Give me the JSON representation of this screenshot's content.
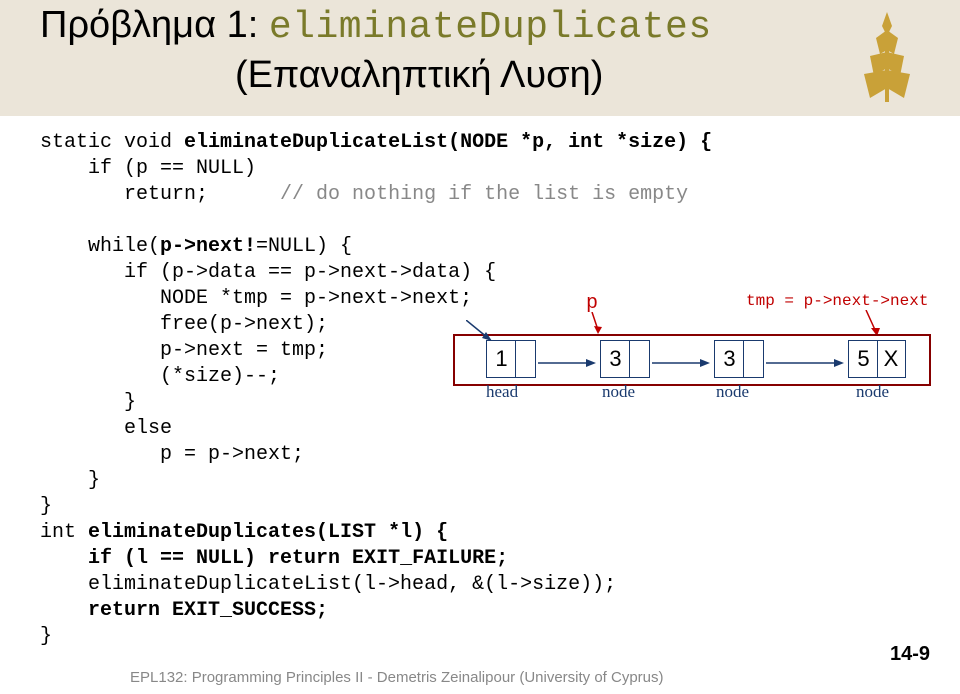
{
  "title": {
    "prefix": "Πρόβλημα 1: ",
    "code": "eliminateDuplicates",
    "line2": "(Επαναληπτική Λυση)"
  },
  "code": {
    "l1a": "static void ",
    "l1b": "eliminateDuplicateList(NODE *p, int *size) {",
    "l2a": "    if (p == NULL)",
    "l3a": "       return;      ",
    "l3b": "// do nothing if the list is empty",
    "l4": " ",
    "l5a": "    while(",
    "l5b": "p->next!",
    "l5c": "=NULL) {",
    "l6": "       if (p->data == p->next->data) {",
    "l7": "          NODE *tmp = p->next->next;",
    "l8": "          free(p->next);",
    "l9": "          p->next = tmp;",
    "l10": "          (*size)--;",
    "l11": "       }",
    "l12": "       else",
    "l13": "          p = p->next;",
    "l14": "    }",
    "l15": "}",
    "l16a": "int ",
    "l16b": "eliminateDuplicates(LIST *l) {",
    "l17a": "    ",
    "l17b": "if (l == NULL) return EXIT_FAILURE;",
    "l18": "    eliminateDuplicateList(l->head, &(l->size));",
    "l19a": "    ",
    "l19b": "return EXIT_SUCCESS;",
    "l20": "}"
  },
  "diagram": {
    "p": "p",
    "tmp": "tmp = p->next->next",
    "head_val": "1",
    "n1_val": "3",
    "n2_val": "3",
    "n3_val": "5",
    "n3_end": "X",
    "lbl_head": "head",
    "lbl_node": "node"
  },
  "footer": "EPL132: Programming Principles II - Demetris Zeinalipour (University of Cyprus)",
  "pagenum": "14-9"
}
